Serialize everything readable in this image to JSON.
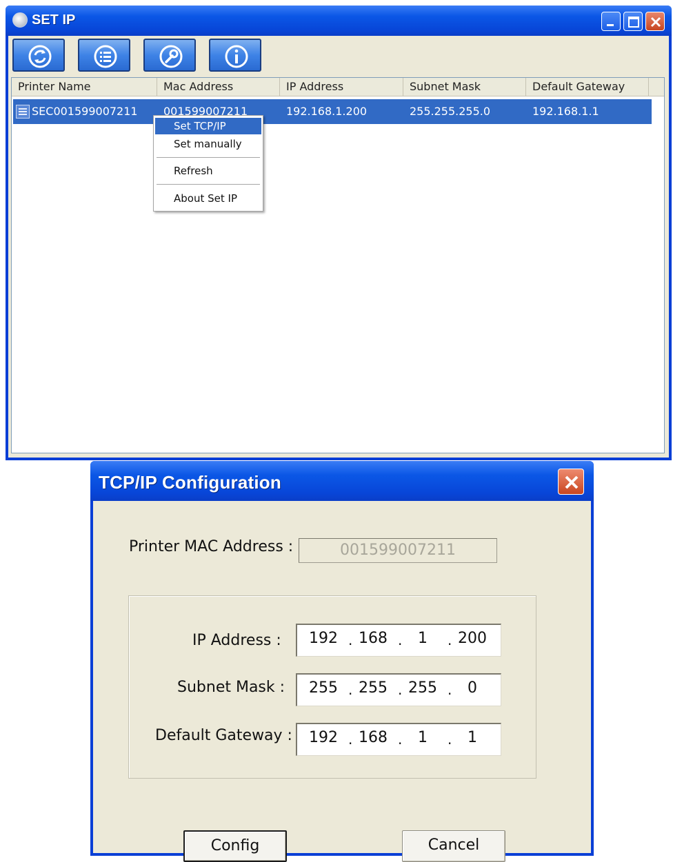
{
  "set_ip_window": {
    "title": "SET IP",
    "toolbar": [
      "refresh-icon",
      "list-icon",
      "wrench-icon",
      "info-icon"
    ],
    "columns": [
      "Printer Name",
      "Mac Address",
      "IP Address",
      "Subnet Mask",
      "Default Gateway"
    ],
    "rows": [
      {
        "printer_name": "SEC001599007211",
        "mac": "001599007211",
        "ip": "192.168.1.200",
        "subnet": "255.255.255.0",
        "gateway": "192.168.1.1"
      }
    ],
    "context_menu": [
      "Set TCP/IP",
      "Set manually",
      "Refresh",
      "About Set IP"
    ]
  },
  "tcpip_dialog": {
    "title": "TCP/IP Configuration",
    "mac_label": "Printer MAC Address :",
    "mac_value": "001599007211",
    "ip_label": "IP Address :",
    "ip": [
      "192",
      "168",
      "1",
      "200"
    ],
    "subnet_label": "Subnet Mask :",
    "subnet": [
      "255",
      "255",
      "255",
      "0"
    ],
    "gateway_label": "Default Gateway :",
    "gateway": [
      "192",
      "168",
      "1",
      "1"
    ],
    "config_button": "Config",
    "cancel_button": "Cancel"
  },
  "colors": {
    "title_blue": "#0b57e6",
    "selection": "#316ac5",
    "dialog_face": "#ece9d8",
    "close_red": "#c94620"
  }
}
